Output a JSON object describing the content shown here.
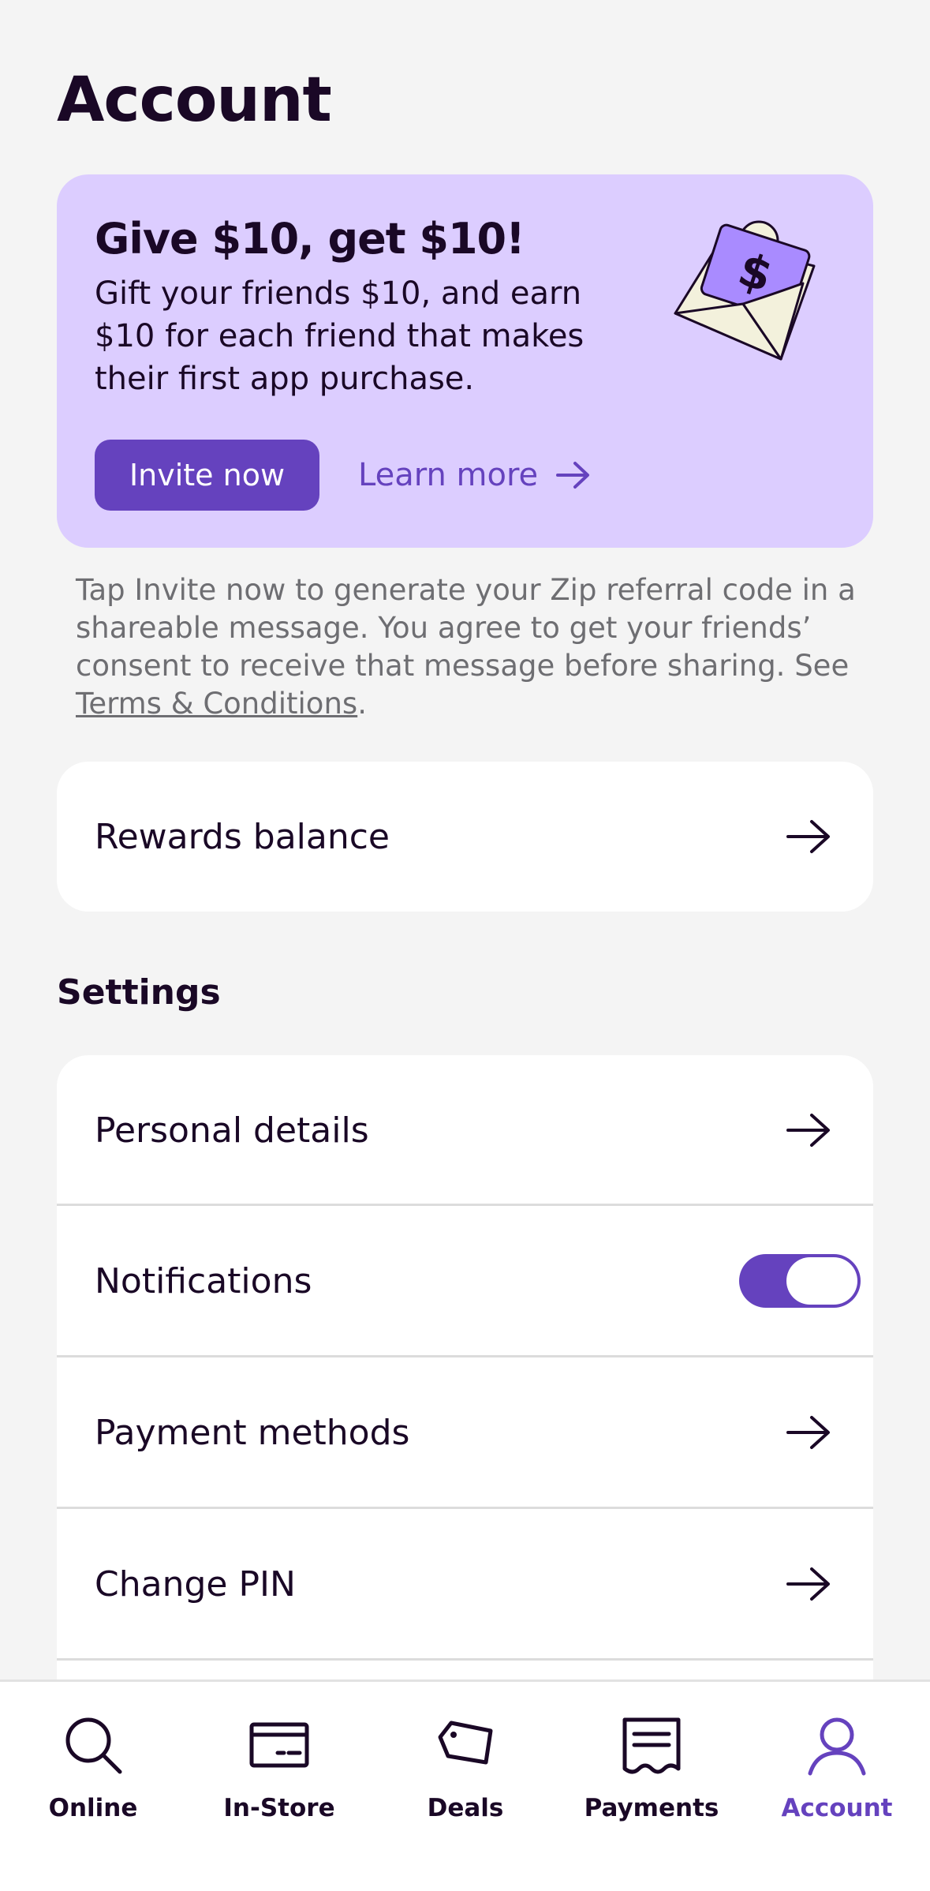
{
  "header": {
    "title": "Account"
  },
  "promo": {
    "title": "Give $10, get $10!",
    "body": "Gift your friends $10, and earn $10 for each friend that makes their first app purchase.",
    "invite_label": "Invite now",
    "learn_more_label": "Learn more",
    "art_symbol": "$"
  },
  "disclaimer": {
    "text": "Tap Invite now to generate your Zip referral code in a shareable message. You agree to get your friends’ consent to receive that message before sharing. See ",
    "link": "Terms & Conditions",
    "suffix": "."
  },
  "rewards": {
    "label": "Rewards balance"
  },
  "settings": {
    "title": "Settings",
    "items": [
      {
        "label": "Personal details",
        "control": "arrow"
      },
      {
        "label": "Notifications",
        "control": "toggle",
        "value": true
      },
      {
        "label": "Payment methods",
        "control": "arrow"
      },
      {
        "label": "Change PIN",
        "control": "arrow"
      }
    ]
  },
  "nav": {
    "items": [
      {
        "label": "Online",
        "icon": "search-icon",
        "active": false
      },
      {
        "label": "In-Store",
        "icon": "card-icon",
        "active": false
      },
      {
        "label": "Deals",
        "icon": "tag-icon",
        "active": false
      },
      {
        "label": "Payments",
        "icon": "receipt-icon",
        "active": false
      },
      {
        "label": "Account",
        "icon": "person-icon",
        "active": true
      }
    ]
  },
  "colors": {
    "accent": "#6542be",
    "promo_bg": "#dccdff",
    "text": "#1a0826",
    "muted": "#6e6e72",
    "background": "#f4f4f4"
  }
}
